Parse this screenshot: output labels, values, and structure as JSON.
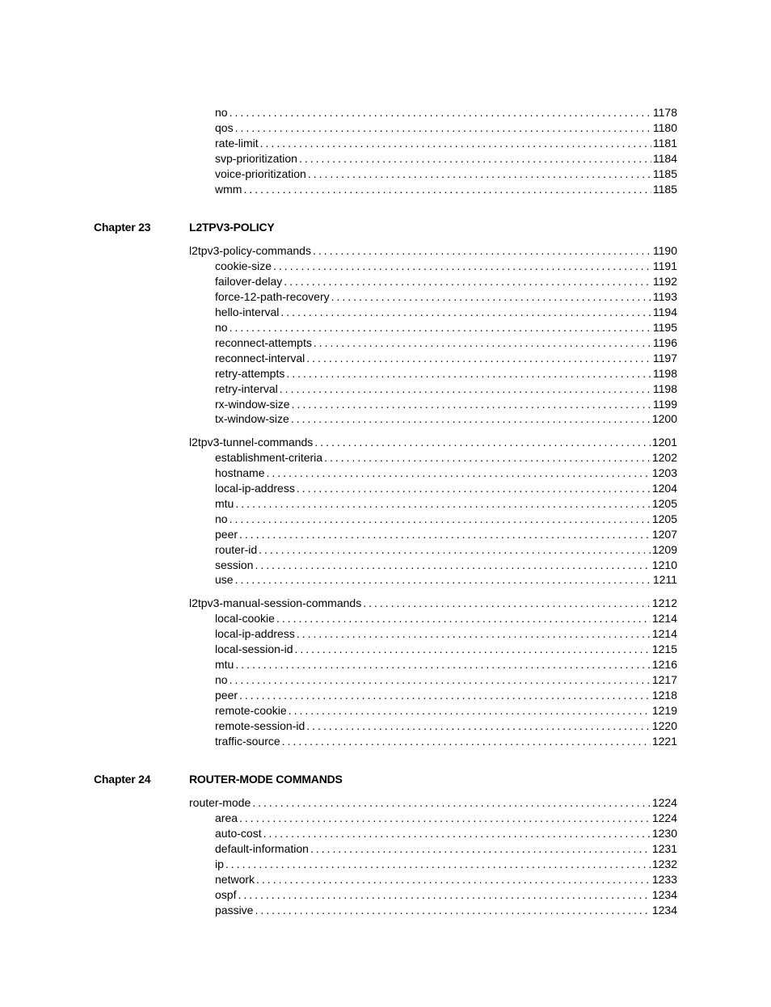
{
  "sections": [
    {
      "groups": [
        {
          "items": [
            {
              "level": 2,
              "text": "no",
              "page": "1178"
            },
            {
              "level": 2,
              "text": "qos",
              "page": "1180"
            },
            {
              "level": 2,
              "text": "rate-limit",
              "page": "1181"
            },
            {
              "level": 2,
              "text": "svp-prioritization",
              "page": "1184"
            },
            {
              "level": 2,
              "text": "voice-prioritization",
              "page": "1185"
            },
            {
              "level": 2,
              "text": "wmm",
              "page": "1185"
            }
          ]
        }
      ]
    },
    {
      "chapter_label": "Chapter 23",
      "chapter_title": "L2TPV3-POLICY",
      "groups": [
        {
          "items": [
            {
              "level": 1,
              "text": "l2tpv3-policy-commands",
              "page": "1190"
            },
            {
              "level": 2,
              "text": "cookie-size",
              "page": "1191"
            },
            {
              "level": 2,
              "text": "failover-delay",
              "page": "1192"
            },
            {
              "level": 2,
              "text": "force-12-path-recovery",
              "page": "1193"
            },
            {
              "level": 2,
              "text": "hello-interval",
              "page": "1194"
            },
            {
              "level": 2,
              "text": "no",
              "page": "1195"
            },
            {
              "level": 2,
              "text": "reconnect-attempts",
              "page": "1196"
            },
            {
              "level": 2,
              "text": "reconnect-interval",
              "page": "1197"
            },
            {
              "level": 2,
              "text": "retry-attempts",
              "page": "1198"
            },
            {
              "level": 2,
              "text": "retry-interval",
              "page": "1198"
            },
            {
              "level": 2,
              "text": "rx-window-size",
              "page": "1199"
            },
            {
              "level": 2,
              "text": "tx-window-size",
              "page": "1200"
            }
          ]
        },
        {
          "items": [
            {
              "level": 1,
              "text": "l2tpv3-tunnel-commands",
              "page": "1201"
            },
            {
              "level": 2,
              "text": "establishment-criteria",
              "page": "1202"
            },
            {
              "level": 2,
              "text": "hostname",
              "page": "1203"
            },
            {
              "level": 2,
              "text": "local-ip-address",
              "page": "1204"
            },
            {
              "level": 2,
              "text": "mtu",
              "page": "1205"
            },
            {
              "level": 2,
              "text": "no",
              "page": "1205"
            },
            {
              "level": 2,
              "text": "peer",
              "page": "1207"
            },
            {
              "level": 2,
              "text": "router-id",
              "page": "1209"
            },
            {
              "level": 2,
              "text": "session",
              "page": "1210"
            },
            {
              "level": 2,
              "text": "use",
              "page": "1211"
            }
          ]
        },
        {
          "items": [
            {
              "level": 1,
              "text": "l2tpv3-manual-session-commands",
              "page": "1212"
            },
            {
              "level": 2,
              "text": "local-cookie",
              "page": "1214"
            },
            {
              "level": 2,
              "text": "local-ip-address",
              "page": "1214"
            },
            {
              "level": 2,
              "text": "local-session-id",
              "page": "1215"
            },
            {
              "level": 2,
              "text": "mtu",
              "page": "1216"
            },
            {
              "level": 2,
              "text": "no",
              "page": "1217"
            },
            {
              "level": 2,
              "text": "peer",
              "page": "1218"
            },
            {
              "level": 2,
              "text": "remote-cookie",
              "page": "1219"
            },
            {
              "level": 2,
              "text": "remote-session-id",
              "page": "1220"
            },
            {
              "level": 2,
              "text": "traffic-source",
              "page": "1221"
            }
          ]
        }
      ]
    },
    {
      "chapter_label": "Chapter 24",
      "chapter_title": "ROUTER-MODE COMMANDS",
      "groups": [
        {
          "items": [
            {
              "level": 1,
              "text": "router-mode",
              "page": "1224"
            },
            {
              "level": 2,
              "text": "area",
              "page": "1224"
            },
            {
              "level": 2,
              "text": "auto-cost",
              "page": "1230"
            },
            {
              "level": 2,
              "text": "default-information",
              "page": "1231"
            },
            {
              "level": 2,
              "text": "ip",
              "page": "1232"
            },
            {
              "level": 2,
              "text": "network",
              "page": "1233"
            },
            {
              "level": 2,
              "text": "ospf",
              "page": "1234"
            },
            {
              "level": 2,
              "text": "passive",
              "page": "1234"
            }
          ]
        }
      ]
    }
  ]
}
